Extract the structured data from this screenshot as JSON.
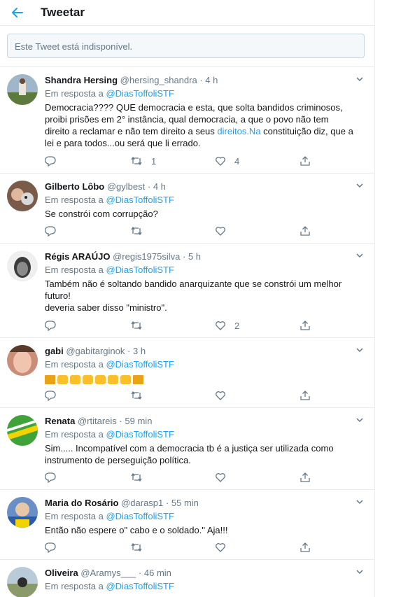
{
  "header": {
    "title": "Tweetar"
  },
  "unavailable": {
    "text": "Este Tweet está indisponível."
  },
  "tweets": [
    {
      "name": "Shandra Hersing",
      "handle": "@hersing_shandra",
      "dot": "·",
      "time": "4 h",
      "reply_prefix": "Em resposta a",
      "reply_to": "@DiasToffoliSTF",
      "text_lines": [
        "Democracia???? QUE democracia e esta, que solta bandidos criminosos,",
        "proibi prisões em 2°  instância, qual  democracia, a  que o povo não tem",
        "direito a reclamar e não tem direito a seus "
      ],
      "link": "direitos.Na",
      "text_after_link": " constituição diz, que a",
      "text_last": "lei e para todos...ou será que li errado.",
      "replies": "",
      "retweets": "1",
      "likes": "4"
    },
    {
      "name": "Gilberto Lôbo",
      "handle": "@gylbest",
      "dot": "·",
      "time": "4 h",
      "reply_prefix": "Em resposta a",
      "reply_to": "@DiasToffoliSTF",
      "text_lines": [
        "Se constrói com corrupção?"
      ],
      "replies": "",
      "retweets": "",
      "likes": ""
    },
    {
      "name": "Régis ARAÚJO",
      "handle": "@regis1975silva",
      "dot": "·",
      "time": "5 h",
      "reply_prefix": "Em resposta a",
      "reply_to": "@DiasToffoliSTF",
      "text_lines": [
        "Também não é soltando bandido anarquizante que se constrói um melhor",
        "futuro!",
        "deveria saber disso \"ministro\"."
      ],
      "replies": "",
      "retweets": "",
      "likes": "2"
    },
    {
      "name": "gabi",
      "handle": "@gabitarginok",
      "dot": "·",
      "time": "3 h",
      "reply_prefix": "Em resposta a",
      "reply_to": "@DiasToffoliSTF",
      "emoji_seq": [
        "scale",
        "clap",
        "clap",
        "clap",
        "clap",
        "clap",
        "clap",
        "scale"
      ],
      "replies": "",
      "retweets": "",
      "likes": ""
    },
    {
      "name": "Renata",
      "handle": "@rtitareis",
      "dot": "·",
      "time": "59 min",
      "reply_prefix": "Em resposta a",
      "reply_to": "@DiasToffoliSTF",
      "text_lines": [
        "Sim..... Incompatível com a democracia tb é a justiça ser utilizada como",
        "instrumento de perseguição política."
      ],
      "replies": "",
      "retweets": "",
      "likes": ""
    },
    {
      "name": "Maria do Rosário",
      "handle": "@darasp1",
      "dot": "·",
      "time": "55 min",
      "reply_prefix": "Em resposta a",
      "reply_to": "@DiasToffoliSTF",
      "text_lines": [
        "Então não espere o\" cabo e o soldado.\" Aja!!!"
      ],
      "replies": "",
      "retweets": "",
      "likes": ""
    },
    {
      "name": "Oliveira",
      "handle": "@Aramys___",
      "dot": "·",
      "time": "46 min",
      "reply_prefix": "Em resposta a",
      "reply_to": "@DiasToffoliSTF",
      "text_lines": [],
      "replies": "",
      "retweets": "",
      "likes": ""
    }
  ],
  "colors": {
    "accent": "#1da1f2",
    "muted": "#657786",
    "border": "#e6ecf0"
  }
}
